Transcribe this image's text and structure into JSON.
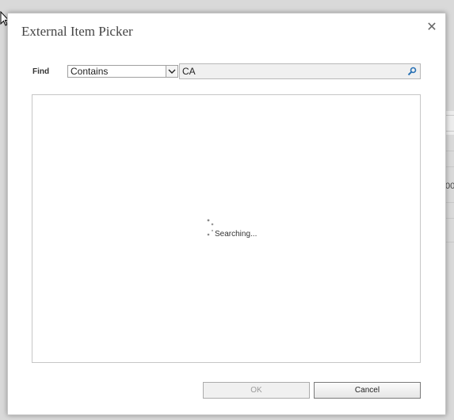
{
  "dialog": {
    "title": "External Item Picker",
    "close_icon": "close-icon"
  },
  "find": {
    "label": "Find",
    "operator": "Contains",
    "query": "CA",
    "search_icon": "search-icon"
  },
  "results": {
    "status": "Searching..."
  },
  "buttons": {
    "ok": "OK",
    "cancel": "Cancel"
  },
  "background": {
    "partial_text": "00"
  },
  "colors": {
    "dialog_bg": "#ffffff",
    "page_bg": "#d9d9d9",
    "search_icon": "#2a72b5"
  }
}
